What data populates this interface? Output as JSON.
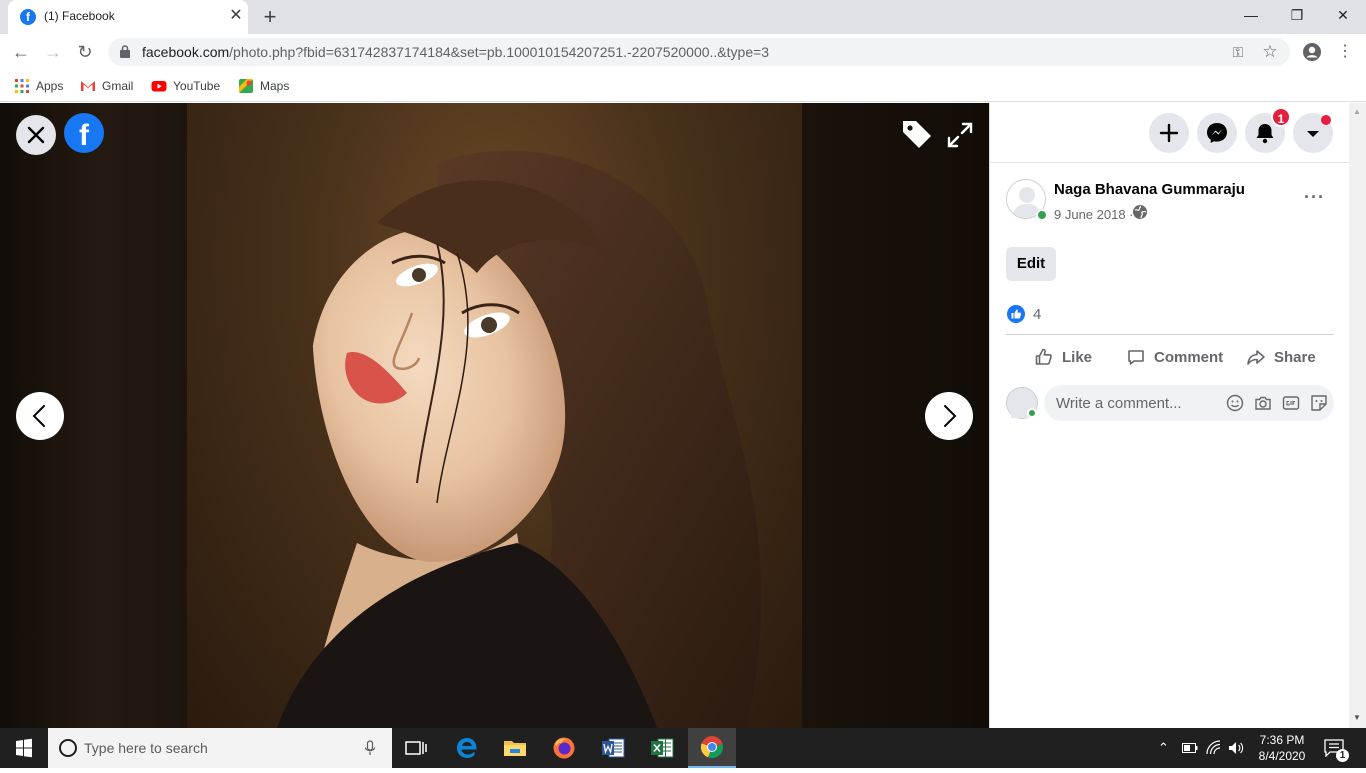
{
  "browser": {
    "tab_title": "(1) Facebook",
    "tab_favicon_letter": "f",
    "new_tab_label": "+",
    "url_host": "facebook.com",
    "url_path": "/photo.php?fbid=631742837174184&set=pb.100010154207251.-2207520000..&type=3",
    "bookmarks": [
      {
        "label": "Apps",
        "icon": "apps-grid-icon"
      },
      {
        "label": "Gmail",
        "icon": "gmail-icon"
      },
      {
        "label": "YouTube",
        "icon": "youtube-icon"
      },
      {
        "label": "Maps",
        "icon": "maps-icon"
      }
    ]
  },
  "viewer": {
    "logo_letter": "f",
    "icons": [
      "close-icon",
      "facebook-logo-icon",
      "tag-icon",
      "fullscreen-icon",
      "chevron-left-icon",
      "chevron-right-icon"
    ]
  },
  "panel": {
    "notification_count": "1",
    "author_name": "Naga Bhavana Gummaraju",
    "post_date": "9 June 2018 ·",
    "more_options": "···",
    "edit_label": "Edit",
    "like_count": "4",
    "actions": {
      "like": "Like",
      "comment": "Comment",
      "share": "Share"
    },
    "comment_placeholder": "Write a comment...",
    "accent_color": "#1877f2",
    "online_color": "#31a24c",
    "badge_color": "#e41e3f"
  },
  "taskbar": {
    "search_placeholder": "Type here to search",
    "time": "7:36 PM",
    "date": "8/4/2020",
    "notification_count": "1",
    "pinned": [
      "task-view-icon",
      "edge-icon",
      "file-explorer-icon",
      "firefox-icon",
      "word-icon",
      "excel-icon",
      "chrome-icon"
    ]
  }
}
